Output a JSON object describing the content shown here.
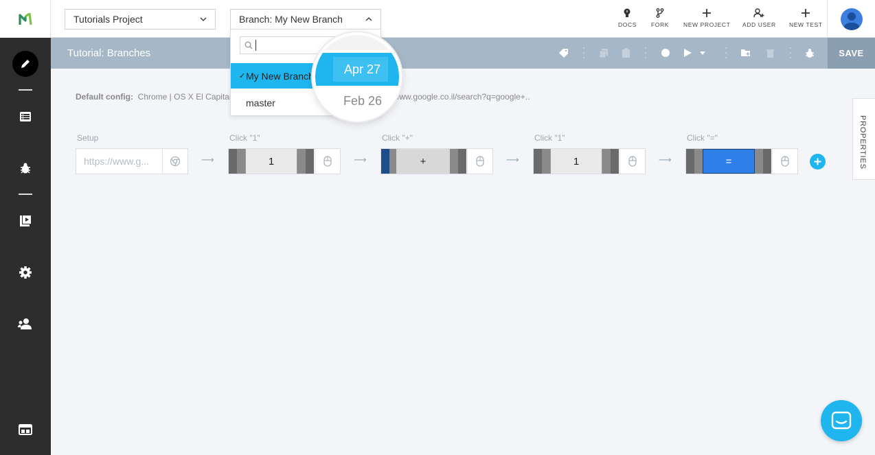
{
  "header": {
    "project_select": "Tutorials Project",
    "branch_select": "Branch: My New Branch",
    "actions": [
      {
        "label": "DOCS",
        "icon": "lightbulb-icon"
      },
      {
        "label": "FORK",
        "icon": "fork-icon"
      },
      {
        "label": "NEW PROJECT",
        "icon": "plus-icon"
      },
      {
        "label": "ADD USER",
        "icon": "add-user-icon"
      },
      {
        "label": "NEW TEST",
        "icon": "plus-icon"
      }
    ]
  },
  "sidebar": {
    "items": [
      "edit-icon",
      "list-icon",
      "bug-icon",
      "play-media-icon",
      "settings-icon",
      "users-icon",
      "window-icon"
    ]
  },
  "titlebar": {
    "title": "Tutorial: Branches",
    "save_label": "SAVE"
  },
  "config": {
    "label": "Default config:",
    "value": "Chrome | OS X El Capitan",
    "url": "/ www.google.co.il/search?q=google+.."
  },
  "steps": [
    {
      "label": "Setup",
      "value": "https://www.g..."
    },
    {
      "label": "Click \"1\"",
      "key": "1"
    },
    {
      "label": "Click \"+\"",
      "key": "+"
    },
    {
      "label": "Click \"1\"",
      "key": "1"
    },
    {
      "label": "Click \"=\"",
      "key": "="
    }
  ],
  "properties_tab": "PROPERTIES",
  "branch_dropdown": {
    "search_placeholder": "",
    "items": [
      {
        "name": "My New Branch",
        "date": "Apr 27",
        "selected": true
      },
      {
        "name": "master",
        "date": "Feb 26",
        "selected": false
      }
    ]
  },
  "colors": {
    "accent": "#1fb6f0",
    "titlebar": "#a6b8c8",
    "sidebar": "#2d2d2d"
  }
}
